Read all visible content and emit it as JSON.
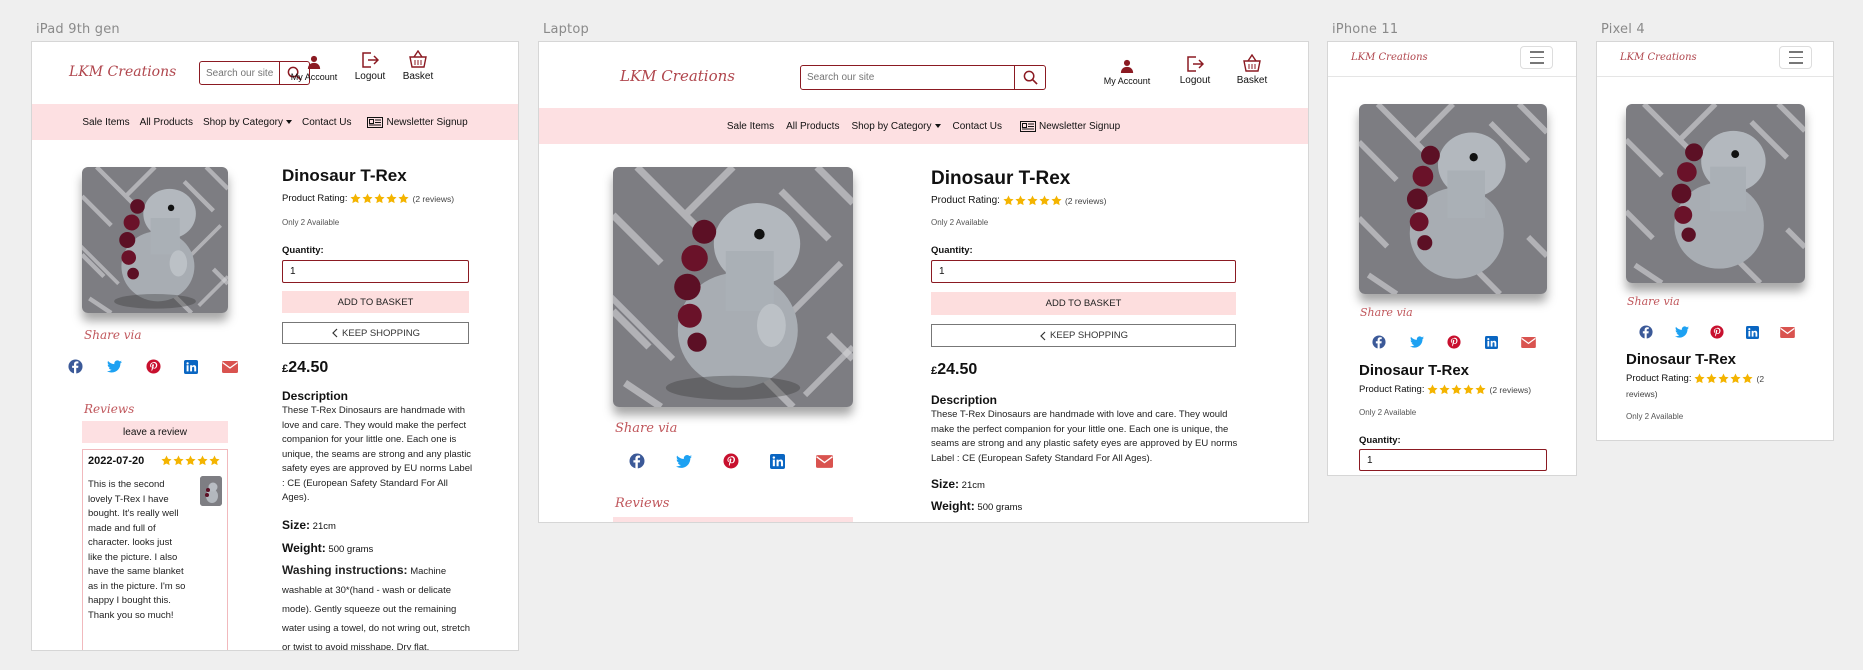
{
  "devices": {
    "ipad": "iPad 9th gen",
    "laptop": "Laptop",
    "iphone": "iPhone 11",
    "pixel": "Pixel 4"
  },
  "header": {
    "logo": "LKM Creations",
    "search_placeholder": "Search our site",
    "account_label": "My Account",
    "logout_label": "Logout",
    "basket_label": "Basket"
  },
  "nav": {
    "sale": "Sale Items",
    "all": "All Products",
    "category": "Shop by Category",
    "contact": "Contact Us",
    "newsletter": "Newsletter Signup"
  },
  "product": {
    "name": "Dinosaur T-Rex",
    "rating_label": "Product Rating:",
    "rating_value": 5,
    "reviews_count": "(2 reviews)",
    "reviews_count_line1": "(2",
    "reviews_count_line2": "reviews)",
    "availability": "Only 2 Available",
    "quantity_label": "Quantity:",
    "quantity_value": "1",
    "add_to_basket": "ADD TO BASKET",
    "keep_shopping": "KEEP SHOPPING",
    "currency": "£",
    "price": "24.50",
    "description_heading": "Description",
    "description": "These T-Rex Dinosaurs are handmade with love and care. They would make the perfect companion for your little one. Each one is unique, the seams are strong and any plastic safety eyes are approved by EU norms Label : CE (European Safety Standard For All Ages).",
    "size_label": "Size:",
    "size_value": "21cm",
    "weight_label": "Weight:",
    "weight_value": "500 grams",
    "washing_label": "Washing instructions:",
    "washing_value": "Machine washable at 30*(hand - wash or delicate mode). Gently squeeze out the remaining water using a towel, do not wring out, stretch or twist to avoid misshape. Dry flat,"
  },
  "share": {
    "label": "Share via",
    "icons": [
      "facebook-icon",
      "twitter-icon",
      "pinterest-icon",
      "linkedin-icon",
      "envelope-icon"
    ],
    "colors": {
      "facebook": "#3b5998",
      "twitter": "#1da1f2",
      "pinterest": "#c8102e",
      "linkedin": "#0a66c2",
      "envelope": "#d9534f"
    }
  },
  "reviews": {
    "heading": "Reviews",
    "leave_review": "leave a review",
    "items": [
      {
        "date": "2022-07-20",
        "stars": 5,
        "text": "This is the second lovely T-Rex I have bought. It's really well made and full of character. looks just like the picture. I also have the same blanket as in the picture. I'm so happy I bought this. Thank you so much!"
      }
    ]
  },
  "colors": {
    "brand": "#8b1a22",
    "logo": "#b0464d",
    "nav_bg": "#fde0e2",
    "button_bg": "#fddede",
    "star": "#f4b400",
    "page_bg": "#efefef"
  }
}
